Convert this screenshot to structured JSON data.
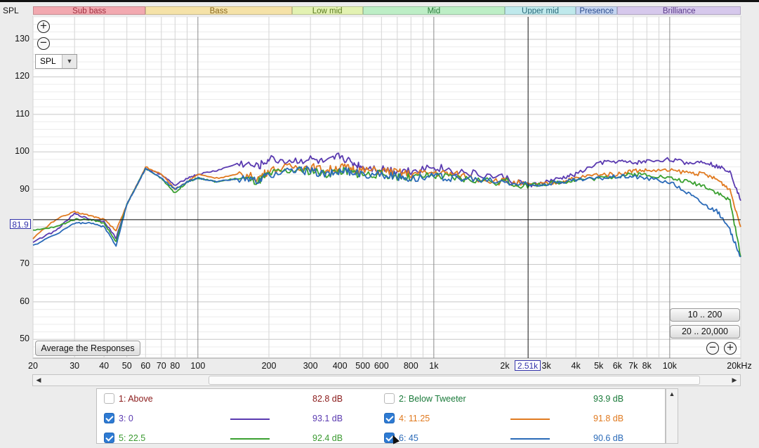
{
  "header": {
    "spl_label": "SPL"
  },
  "bands": [
    {
      "label": "Sub bass",
      "from": 20,
      "to": 60,
      "bg": "#f2a9b0",
      "fg": "#a03040"
    },
    {
      "label": "Bass",
      "from": 60,
      "to": 250,
      "bg": "#f5e2a8",
      "fg": "#8a6a20"
    },
    {
      "label": "Low mid",
      "from": 250,
      "to": 500,
      "bg": "#e3f2b2",
      "fg": "#5a7a20"
    },
    {
      "label": "Mid",
      "from": 500,
      "to": 2000,
      "bg": "#bdeec6",
      "fg": "#2a7a3a"
    },
    {
      "label": "Upper mid",
      "from": 2000,
      "to": 4000,
      "bg": "#bfe9ec",
      "fg": "#2a6a7a"
    },
    {
      "label": "Presence",
      "from": 4000,
      "to": 6000,
      "bg": "#c5d5f2",
      "fg": "#2a4a8a"
    },
    {
      "label": "Brilliance",
      "from": 6000,
      "to": 20000,
      "bg": "#d6c8ec",
      "fg": "#5a3a8a"
    }
  ],
  "controls": {
    "zoom_in_icon": "plus-circle-icon",
    "zoom_out_icon": "minus-circle-icon",
    "spl_select": "SPL",
    "average_button": "Average the Responses",
    "range_button_1": "10 .. 200",
    "range_button_2": "20 .. 20,000",
    "cursor_y": "81.9",
    "cursor_x": "2.51k"
  },
  "chart_data": {
    "type": "line",
    "xscale": "log",
    "xlim": [
      20,
      20000
    ],
    "ylim": [
      45,
      136
    ],
    "grid": true,
    "x_tick_labels": [
      "20",
      "30",
      "40",
      "50",
      "60",
      "70",
      "80",
      "100",
      "200",
      "300",
      "400",
      "500",
      "600",
      "800",
      "1k",
      "2k",
      "3k",
      "4k",
      "5k",
      "6k",
      "7k",
      "8k",
      "10k",
      "20kHz"
    ],
    "x_tick_values": [
      20,
      30,
      40,
      50,
      60,
      70,
      80,
      100,
      200,
      300,
      400,
      500,
      600,
      800,
      1000,
      2000,
      3000,
      4000,
      5000,
      6000,
      7000,
      8000,
      10000,
      20000
    ],
    "y_ticks": [
      50,
      60,
      70,
      80,
      90,
      100,
      110,
      120,
      130
    ],
    "cursor": {
      "x": 2510,
      "y": 81.9
    },
    "x": [
      20,
      25,
      30,
      35,
      40,
      45,
      50,
      55,
      60,
      70,
      80,
      90,
      100,
      120,
      150,
      180,
      200,
      250,
      300,
      350,
      400,
      450,
      500,
      600,
      700,
      800,
      1000,
      1200,
      1500,
      2000,
      2500,
      3000,
      3500,
      4000,
      5000,
      6000,
      7000,
      8000,
      10000,
      12000,
      14000,
      16000,
      18000,
      20000
    ],
    "series": [
      {
        "name": "1: Above",
        "color": "#a02020",
        "visible": false,
        "level": "82.8 dB",
        "values": []
      },
      {
        "name": "2: Below Tweeter",
        "color": "#1a8a3a",
        "visible": false,
        "level": "93.9 dB",
        "values": []
      },
      {
        "name": "3: 0",
        "color": "#5a3ab0",
        "visible": true,
        "level": "93.1 dB",
        "values": [
          76,
          79,
          83.5,
          82,
          81.5,
          77,
          86,
          91,
          95.5,
          94,
          91,
          93,
          94,
          95,
          97,
          96,
          98,
          97.5,
          98,
          97,
          99,
          97,
          96,
          95.5,
          95,
          95,
          96,
          95,
          94,
          93,
          91,
          92,
          93,
          94,
          97,
          97.5,
          97,
          97.5,
          98,
          97,
          97.5,
          96,
          95,
          87
        ]
      },
      {
        "name": "4: 11.25",
        "color": "#e07a20",
        "visible": true,
        "level": "91.8 dB",
        "values": [
          77,
          82,
          84,
          83,
          82,
          79,
          86,
          91,
          96,
          94,
          90,
          92,
          94,
          93,
          94,
          93,
          95,
          96,
          96,
          95,
          96,
          95.5,
          95,
          95,
          94.5,
          94,
          94.5,
          94,
          93,
          92,
          91,
          91.5,
          92,
          93,
          94,
          94,
          95,
          95,
          95,
          94.5,
          94,
          92.5,
          90,
          80
        ]
      },
      {
        "name": "5: 22.5",
        "color": "#3aa030",
        "visible": true,
        "level": "92.4 dB",
        "values": [
          79,
          80,
          82,
          82,
          81,
          76,
          86,
          91,
          95.5,
          93,
          89,
          92,
          93,
          92,
          93,
          92,
          94,
          95,
          95,
          94,
          95,
          94.5,
          94,
          94,
          93.5,
          93,
          93.5,
          93,
          92.5,
          92,
          91,
          91.5,
          92,
          92.5,
          93,
          93.5,
          94,
          94,
          93,
          92,
          91,
          89,
          87,
          72
        ]
      },
      {
        "name": "6: 45",
        "color": "#2a6ab8",
        "visible": true,
        "level": "90.6 dB",
        "values": [
          75,
          78,
          81,
          81,
          80,
          75,
          86,
          91,
          95.5,
          93,
          90,
          92,
          93,
          92,
          93,
          92,
          94,
          95,
          95,
          94,
          95,
          94.5,
          94,
          94,
          93.5,
          93,
          93.5,
          93,
          92.5,
          92,
          91,
          91.5,
          92,
          92.5,
          93,
          93.5,
          93.5,
          93,
          92,
          89,
          86,
          84,
          79,
          72
        ]
      }
    ]
  }
}
